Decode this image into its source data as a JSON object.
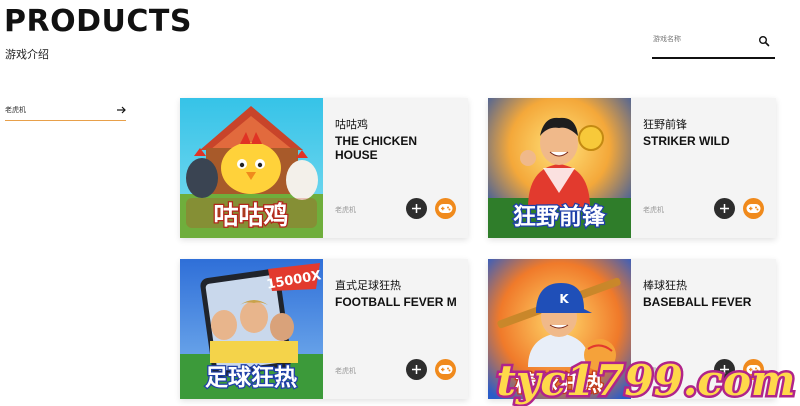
{
  "header": {
    "title": "PRODUCTS",
    "subtitle": "游戏介绍"
  },
  "search": {
    "placeholder": "游戏名称"
  },
  "filter": {
    "selected": "老虎机"
  },
  "games": [
    {
      "name_cn": "咕咕鸡",
      "name_en": "THE CHICKEN HOUSE",
      "category": "老虎机",
      "thumb_text": "咕咕鸡"
    },
    {
      "name_cn": "狂野前锋",
      "name_en": "STRIKER WILD",
      "category": "老虎机",
      "thumb_text": "狂野前锋"
    },
    {
      "name_cn": "直式足球狂热",
      "name_en": "FOOTBALL FEVER M",
      "category": "老虎机",
      "thumb_text": "足球狂热",
      "thumb_badge": "15000X"
    },
    {
      "name_cn": "棒球狂热",
      "name_en": "BASEBALL FEVER",
      "category": "老虎机",
      "thumb_text": "棒球狂热"
    }
  ],
  "watermark": {
    "text": "tyc1799.com"
  },
  "colors": {
    "accent": "#f08a1c",
    "dark_button": "#2d2d2d",
    "watermark": "#ffd84a"
  }
}
